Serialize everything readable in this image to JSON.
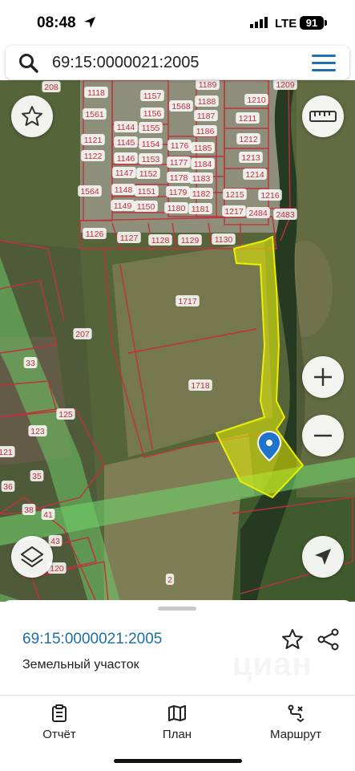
{
  "status_bar": {
    "time": "08:48",
    "network": "LTE",
    "battery": "91"
  },
  "search": {
    "query": "69:15:0000021:2005"
  },
  "map": {
    "parcel_labels": [
      "208",
      "1118",
      "1157",
      "1189",
      "1209",
      "1210",
      "1561",
      "1156",
      "1568",
      "1188",
      "1211",
      "1144",
      "1155",
      "1187",
      "1121",
      "1145",
      "1154",
      "1176",
      "1186",
      "1212",
      "1122",
      "1146",
      "1153",
      "1185",
      "1213",
      "1147",
      "1152",
      "1177",
      "1184",
      "1214",
      "1564",
      "1148",
      "1151",
      "1178",
      "1183",
      "1149",
      "1150",
      "1179",
      "1182",
      "1215",
      "1216",
      "1180",
      "1181",
      "1217",
      "2484",
      "2483",
      "1126",
      "1127",
      "1128",
      "1129",
      "1130",
      "1717",
      "207",
      "1718",
      "33",
      "125",
      "123",
      "121",
      "35",
      "36",
      "38",
      "41",
      "43",
      "120",
      "2"
    ],
    "selected_parcel_color": "#e8f000",
    "boundary_color": "#c0313d",
    "road_color": "#6fd16a"
  },
  "controls": {
    "favorite_icon": "star-outline-icon",
    "ruler_icon": "ruler-icon",
    "zoom_in_icon": "plus-icon",
    "zoom_out_icon": "minus-icon",
    "layers_icon": "layers-icon",
    "locate_icon": "navigation-arrow-icon"
  },
  "sheet": {
    "cadastral_number": "69:15:0000021:2005",
    "object_type": "Земельный участок",
    "watermark": "циан"
  },
  "tabs": [
    {
      "label": "Отчёт",
      "icon": "report-icon"
    },
    {
      "label": "План",
      "icon": "map-plan-icon"
    },
    {
      "label": "Маршрут",
      "icon": "route-icon"
    }
  ]
}
